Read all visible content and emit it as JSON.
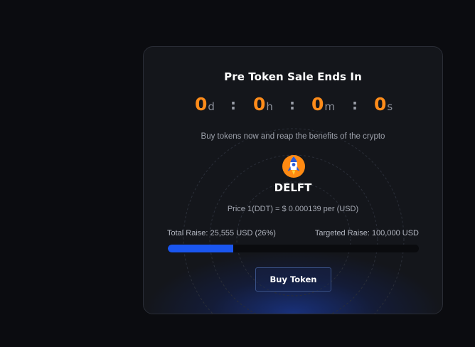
{
  "sale": {
    "title": "Pre Token Sale Ends In",
    "countdown": [
      {
        "value": "0",
        "unit": "d"
      },
      {
        "value": "0",
        "unit": "h"
      },
      {
        "value": "0",
        "unit": "m"
      },
      {
        "value": "0",
        "unit": "s"
      }
    ],
    "separator": ":",
    "subtitle": "Buy tokens now and reap the benefits of the crypto",
    "logo_icon": "rocket-icon",
    "token_name": "DELFT",
    "price_text": "Price 1(DDT) = $ 0.000139 per (USD)",
    "total_raise": "Total Raise: 25,555 USD (26%)",
    "targeted_raise": "Targeted Raise: 100,000 USD",
    "progress_fraction": 0.26,
    "buy_label": "Buy Token"
  },
  "colors": {
    "accent_orange": "#ff8c1a",
    "progress_blue": "#1a56f0",
    "card_bg": "#14161b",
    "page_bg": "#0b0c10"
  }
}
